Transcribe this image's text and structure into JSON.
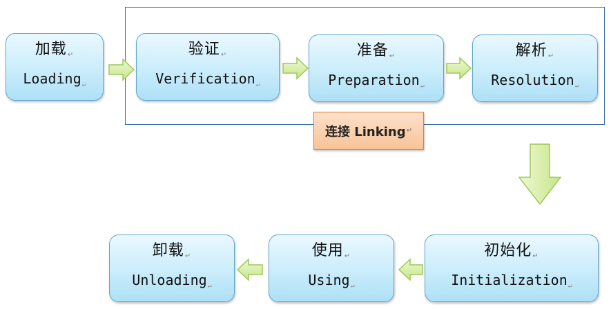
{
  "stages": {
    "loading": {
      "cn": "加载",
      "en": "Loading"
    },
    "verification": {
      "cn": "验证",
      "en": "Verification"
    },
    "preparation": {
      "cn": "准备",
      "en": "Preparation"
    },
    "resolution": {
      "cn": "解析",
      "en": "Resolution"
    },
    "initialization": {
      "cn": "初始化",
      "en": "Initialization"
    },
    "using": {
      "cn": "使用",
      "en": "Using"
    },
    "unloading": {
      "cn": "卸载",
      "en": "Unloading"
    }
  },
  "group": {
    "label": "连接 Linking"
  },
  "mark": "↵",
  "colors": {
    "box_border": "#5aa8cf",
    "box_fill": "#cdeefc",
    "arrow_fill": "#d9f0a8",
    "arrow_stroke": "#9cc85a",
    "linking_fill": "#f9c398",
    "linking_border": "#e07c34",
    "group_border": "#3d6fa6"
  }
}
